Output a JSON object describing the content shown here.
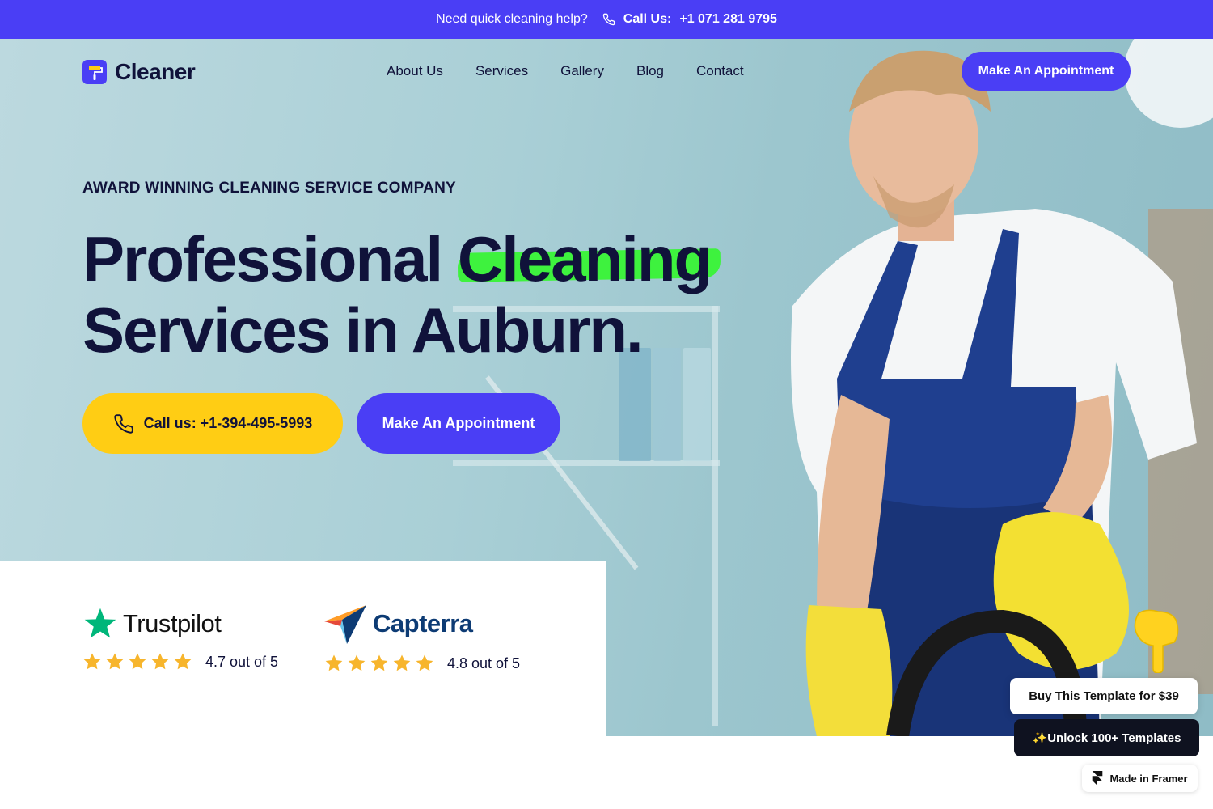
{
  "topbar": {
    "help_text": "Need quick cleaning help?",
    "call_label": "Call Us:",
    "call_number": "+1 071 281 9795",
    "phone_icon": "phone-icon"
  },
  "header": {
    "logo_text": "Cleaner",
    "logo_icon": "paint-roller-icon",
    "nav": [
      "About Us",
      "Services",
      "Gallery",
      "Blog",
      "Contact"
    ],
    "cta_label": "Make An Appointment"
  },
  "hero": {
    "kicker": "AWARD WINNING CLEANING SERVICE COMPANY",
    "headline_part1": "Professional",
    "headline_highlight": "Cleaning",
    "headline_line2": "Services in Auburn.",
    "call_button": "Call us: +1-394-495-5993",
    "appointment_button": "Make An Appointment"
  },
  "ratings": [
    {
      "brand": "Trustpilot",
      "score_text": "4.7 out of 5",
      "stars": 5
    },
    {
      "brand": "Capterra",
      "score_text": "4.8 out of 5",
      "stars": 5
    }
  ],
  "framer": {
    "buy_label": "Buy This Template for $39",
    "unlock_label": "✨Unlock 100+ Templates",
    "made_in": "Made in Framer"
  },
  "colors": {
    "accent": "#4a3ef5",
    "yellow": "#ffcd14",
    "highlight_green": "#3ef23e",
    "text_dark": "#10123a",
    "trustpilot_green": "#00b67a",
    "star": "#f7b52c"
  }
}
